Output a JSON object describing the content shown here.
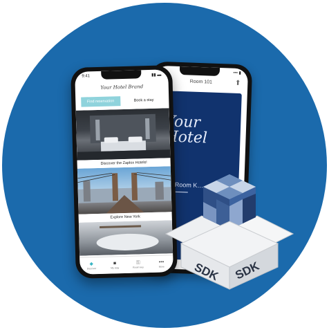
{
  "back_phone": {
    "status": "••• ▮",
    "title": "Room 101",
    "script_line1": "Your",
    "script_line2": "Hotel",
    "room_key": "Your Room K…"
  },
  "front_phone": {
    "time": "9:41",
    "brand": "Your Hotel Brand",
    "find_label": "Find reservation",
    "book_label": "Book a stay",
    "tiles": [
      {
        "caption": "Discover the Zaplox Hotels!"
      },
      {
        "caption": "Explore New York"
      }
    ],
    "tabs": [
      {
        "icon": "◆",
        "label": "Discover"
      },
      {
        "icon": "■",
        "label": "My stay"
      },
      {
        "icon": "⚿",
        "label": "Room key"
      },
      {
        "icon": "•••",
        "label": "More"
      }
    ]
  },
  "sdk_box": {
    "label_left": "SDK",
    "label_right": "SDK"
  },
  "colors": {
    "circle": "#1b6aac",
    "card_navy": "#11336e",
    "accent_teal": "#8fd3dc"
  }
}
